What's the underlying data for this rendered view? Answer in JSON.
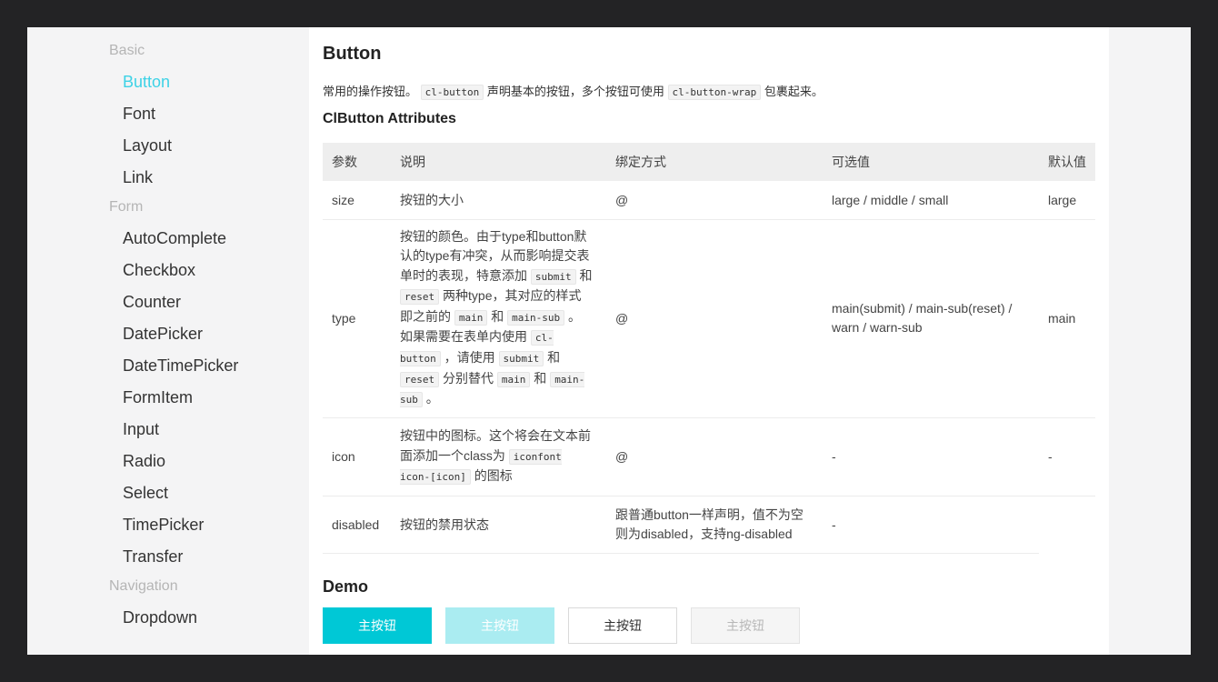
{
  "sidebar": {
    "basic_label": "Basic",
    "basic_items": [
      "Button",
      "Font",
      "Layout",
      "Link"
    ],
    "form_label": "Form",
    "form_items": [
      "AutoComplete",
      "Checkbox",
      "Counter",
      "DatePicker",
      "DateTimePicker",
      "FormItem",
      "Input",
      "Radio",
      "Select",
      "TimePicker",
      "Transfer"
    ],
    "navigation_label": "Navigation",
    "navigation_items": [
      "Dropdown"
    ],
    "active_item": "Button",
    "active_color": "#3dd2e6"
  },
  "page": {
    "title": "Button",
    "desc_part1": "常用的操作按钮。",
    "desc_code1": "cl-button",
    "desc_part2": "声明基本的按钮，多个按钮可使用",
    "desc_code2": "cl-button-wrap",
    "desc_part3": "包裹起来。",
    "attributes_title": "ClButton Attributes"
  },
  "table": {
    "headers": [
      "参数",
      "说明",
      "绑定方式",
      "可选值",
      "默认值"
    ],
    "rows": {
      "size": {
        "param": "size",
        "desc": "按钮的大小",
        "binding": "@",
        "options": "large / middle / small",
        "default": "large"
      },
      "type": {
        "param": "type",
        "desc": {
          "t1": "按钮的颜色。由于type和button默认的type有冲突，从而影响提交表单时的表现，特意添加",
          "c1": "submit",
          "t2": "和",
          "c2": "reset",
          "t3": "两种type，其对应的样式即之前的",
          "c3": "main",
          "t4": "和",
          "c4": "main-sub",
          "t5": "。如果需要在表单内使用",
          "c5": "cl-button",
          "t6": "，请使用",
          "c6": "submit",
          "t7": "和",
          "c7": "reset",
          "t8": "分别替代",
          "c8": "main",
          "t9": "和",
          "c9": "main-sub",
          "t10": "。"
        },
        "binding": "@",
        "options": "main(submit) / main-sub(reset) / warn / warn-sub",
        "default": "main"
      },
      "icon": {
        "param": "icon",
        "desc": {
          "t1": "按钮中的图标。这个将会在文本前面添加一个class为",
          "c1": "iconfont icon-[icon]",
          "t2": "的图标"
        },
        "binding": "@",
        "options": "-",
        "default": "-"
      },
      "disabled": {
        "param": "disabled",
        "desc": "按钮的禁用状态",
        "binding": "跟普通button一样声明，值不为空则为disabled，支持ng-disabled",
        "options": "-",
        "default": ""
      }
    }
  },
  "demo": {
    "title": "Demo",
    "buttons": [
      "主按钮",
      "主按钮",
      "主按钮",
      "主按钮"
    ],
    "primary_color": "#00c8d6"
  }
}
